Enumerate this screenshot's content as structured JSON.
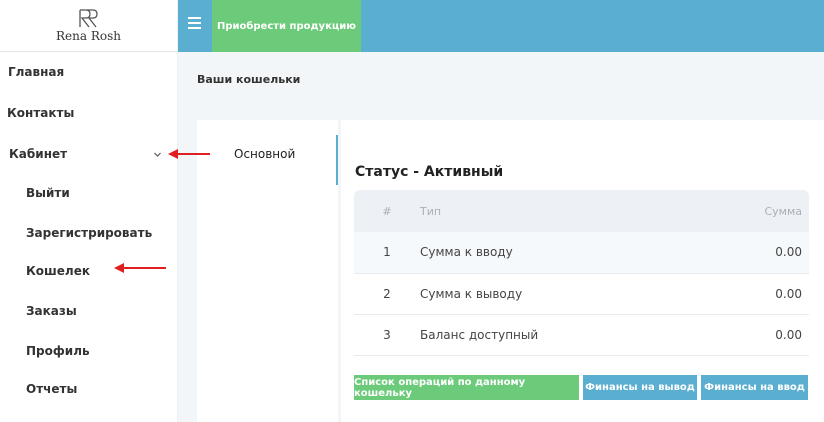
{
  "brand": {
    "logo_text": "Rena Rosh"
  },
  "topbar": {
    "buy_label": "Приобрести продукцию"
  },
  "sidebar": {
    "items": [
      {
        "label": "Главная"
      },
      {
        "label": "Контакты"
      },
      {
        "label": "Кабинет"
      }
    ],
    "sub_items": [
      {
        "label": "Выйти"
      },
      {
        "label": "Зарегистрировать"
      },
      {
        "label": "Кошелек"
      },
      {
        "label": "Заказы"
      },
      {
        "label": "Профиль"
      },
      {
        "label": "Отчеты"
      }
    ]
  },
  "main": {
    "title": "Ваши кошельки",
    "wallet_tab": "Основной",
    "status": "Статус - Активный",
    "table": {
      "headers": [
        "#",
        "Тип",
        "Сумма"
      ],
      "rows": [
        {
          "num": "1",
          "type": "Сумма к вводу",
          "sum": "0.00"
        },
        {
          "num": "2",
          "type": "Сумма к выводу",
          "sum": "0.00"
        },
        {
          "num": "3",
          "type": "Баланс доступный",
          "sum": "0.00"
        }
      ]
    },
    "buttons": {
      "operations": "Список операций по данному кошельку",
      "withdraw": "Финансы на вывод",
      "deposit": "Финансы на ввод"
    }
  },
  "colors": {
    "accent_blue": "#5aaed0",
    "accent_green": "#6ccb7a",
    "annotation_red": "#e02020"
  }
}
